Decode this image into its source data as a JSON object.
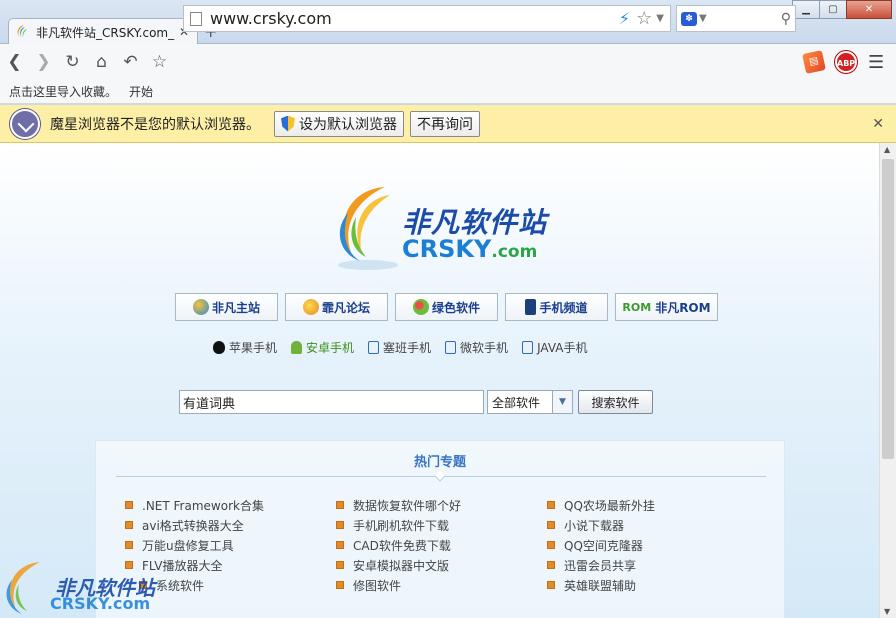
{
  "window": {
    "minimize": "▁",
    "maximize": "▢",
    "close": "✕"
  },
  "tab": {
    "title": "非凡软件站_CRSKY.com_"
  },
  "toolbar": {
    "url": "www.crsky.com"
  },
  "bookmarks": [
    "点击这里导入收藏。",
    "开始"
  ],
  "infobar": {
    "message": "魔星浏览器不是您的默认浏览器。",
    "set_default": "设为默认浏览器",
    "dont_ask": "不再询问"
  },
  "site": {
    "logo_cn": "非凡软件站",
    "logo_en": "CRSKY",
    "logo_en_suffix": ".com",
    "nav": [
      "非凡主站",
      "霏凡论坛",
      "绿色软件",
      "手机频道",
      "非凡ROM"
    ],
    "nav_rom_prefix": "ROM",
    "phones": [
      "苹果手机",
      "安卓手机",
      "塞班手机",
      "微软手机",
      "JAVA手机"
    ],
    "search_value": "有道词典",
    "search_category": "全部软件",
    "search_button": "搜索软件",
    "hot_title": "热门专题",
    "hot_col1": [
      ".NET Framework合集",
      "avi格式转换器大全",
      "万能u盘修复工具",
      "FLV播放器大全",
      "系统软件"
    ],
    "hot_col2": [
      "数据恢复软件哪个好",
      "手机刷机软件下载",
      "CAD软件免费下载",
      "安卓模拟器中文版",
      "修图软件"
    ],
    "hot_col3": [
      "QQ农场最新外挂",
      "小说下载器",
      "QQ空间克隆器",
      "迅雷会员共享",
      "英雄联盟辅助"
    ]
  },
  "watermark": {
    "cn": "非凡软件站",
    "en": "CRSKY.com"
  },
  "colors": {
    "infobar_bg": "#fdf0a6",
    "link_blue": "#1a3f8f",
    "hot_title": "#3874c4",
    "bullet": "#e08a2a"
  }
}
